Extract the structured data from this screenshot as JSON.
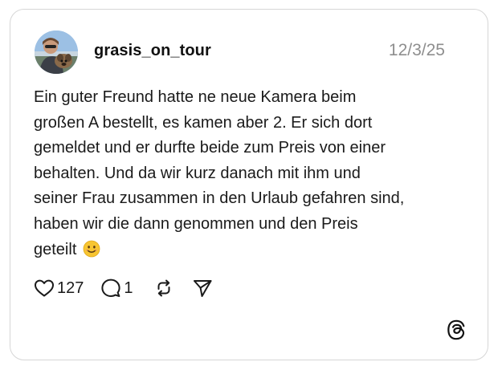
{
  "post": {
    "username": "grasis_on_tour",
    "date": "12/3/25",
    "text_lines": [
      "Ein guter Freund hatte ne neue Kamera beim",
      "großen A bestellt, es kamen aber 2. Er sich dort",
      "gemeldet und er durfte beide zum Preis von einer",
      "behalten. Und da wir kurz danach mit ihm und",
      "seiner Frau zusammen in den Urlaub gefahren sind,",
      "haben wir die dann genommen und den Preis",
      "geteilt"
    ],
    "emoji": "smiling-face-emoji"
  },
  "actions": {
    "likes": "127",
    "replies": "1"
  },
  "icons": {
    "like": "heart-icon",
    "reply": "comment-bubble-icon",
    "repost": "repost-icon",
    "share": "send-icon",
    "brand": "threads-logo-icon"
  },
  "colors": {
    "text": "#1a1a1a",
    "date": "#8e8e8e",
    "border": "#d6d6d6",
    "emoji": "#f7c531"
  }
}
